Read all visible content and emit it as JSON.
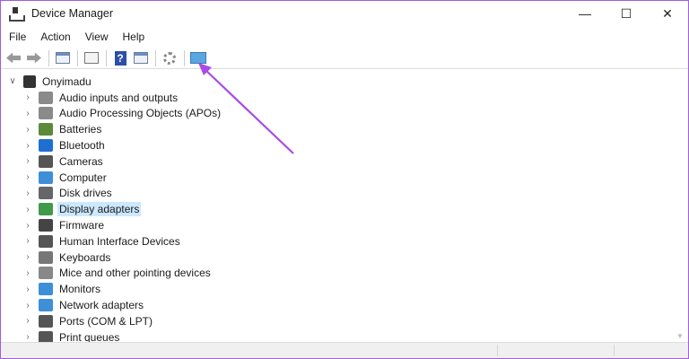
{
  "window": {
    "title": "Device Manager",
    "minimize": "—",
    "maximize": "☐",
    "close": "✕"
  },
  "menu": [
    "File",
    "Action",
    "View",
    "Help"
  ],
  "toolbar": {
    "buttons": [
      "back",
      "forward",
      "show-hide-console-tree",
      "properties",
      "help",
      "action-pane",
      "update-driver",
      "scan-for-hardware-changes"
    ]
  },
  "tree": {
    "root": "Onyimadu",
    "items": [
      {
        "label": "Audio inputs and outputs",
        "color": "#8a8a8a"
      },
      {
        "label": "Audio Processing Objects (APOs)",
        "color": "#8a8a8a"
      },
      {
        "label": "Batteries",
        "color": "#5a8a3a"
      },
      {
        "label": "Bluetooth",
        "color": "#1f6fd1"
      },
      {
        "label": "Cameras",
        "color": "#555555"
      },
      {
        "label": "Computer",
        "color": "#3d8fd8"
      },
      {
        "label": "Disk drives",
        "color": "#666666"
      },
      {
        "label": "Display adapters",
        "color": "#3f9a4a",
        "selected": true
      },
      {
        "label": "Firmware",
        "color": "#444444"
      },
      {
        "label": "Human Interface Devices",
        "color": "#555555"
      },
      {
        "label": "Keyboards",
        "color": "#777777"
      },
      {
        "label": "Mice and other pointing devices",
        "color": "#888888"
      },
      {
        "label": "Monitors",
        "color": "#3d8fd8"
      },
      {
        "label": "Network adapters",
        "color": "#3d8fd8"
      },
      {
        "label": "Ports (COM & LPT)",
        "color": "#555555"
      },
      {
        "label": "Print queues",
        "color": "#555555"
      }
    ]
  },
  "colors": {
    "annotation": "#a94be6",
    "selection": "#cce8ff"
  }
}
